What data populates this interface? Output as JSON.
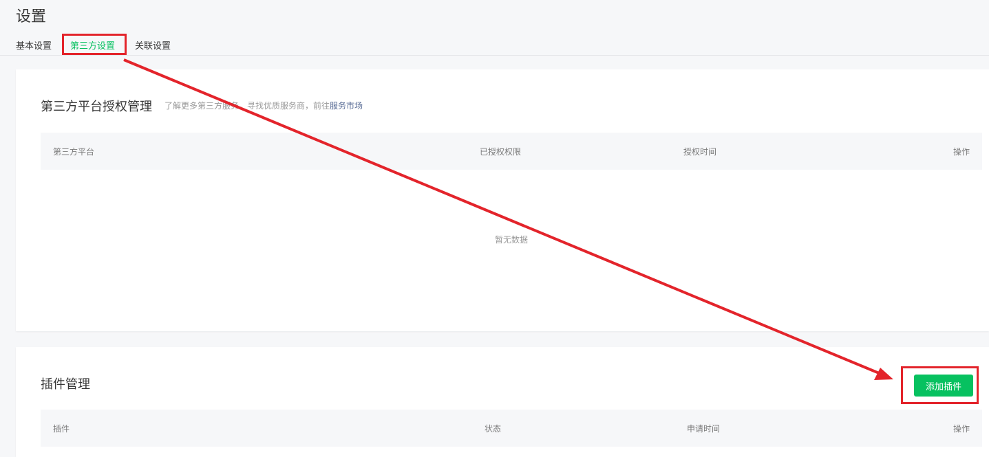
{
  "page": {
    "title": "设置"
  },
  "tabs": [
    {
      "label": "基本设置",
      "active": false
    },
    {
      "label": "第三方设置",
      "active": true
    },
    {
      "label": "关联设置",
      "active": false
    }
  ],
  "auth_section": {
    "title": "第三方平台授权管理",
    "desc_prefix": "了解更多第三方服务，寻找优质服务商，前往",
    "desc_link": "服务市场",
    "columns": [
      "第三方平台",
      "已授权权限",
      "授权时间",
      "操作"
    ],
    "empty_text": "暂无数据"
  },
  "plugin_section": {
    "title": "插件管理",
    "add_button": "添加插件",
    "columns": [
      "插件",
      "状态",
      "申请时间",
      "操作"
    ]
  },
  "colors": {
    "accent": "#07c160",
    "link": "#576b95",
    "annotation": "#e3242b"
  }
}
